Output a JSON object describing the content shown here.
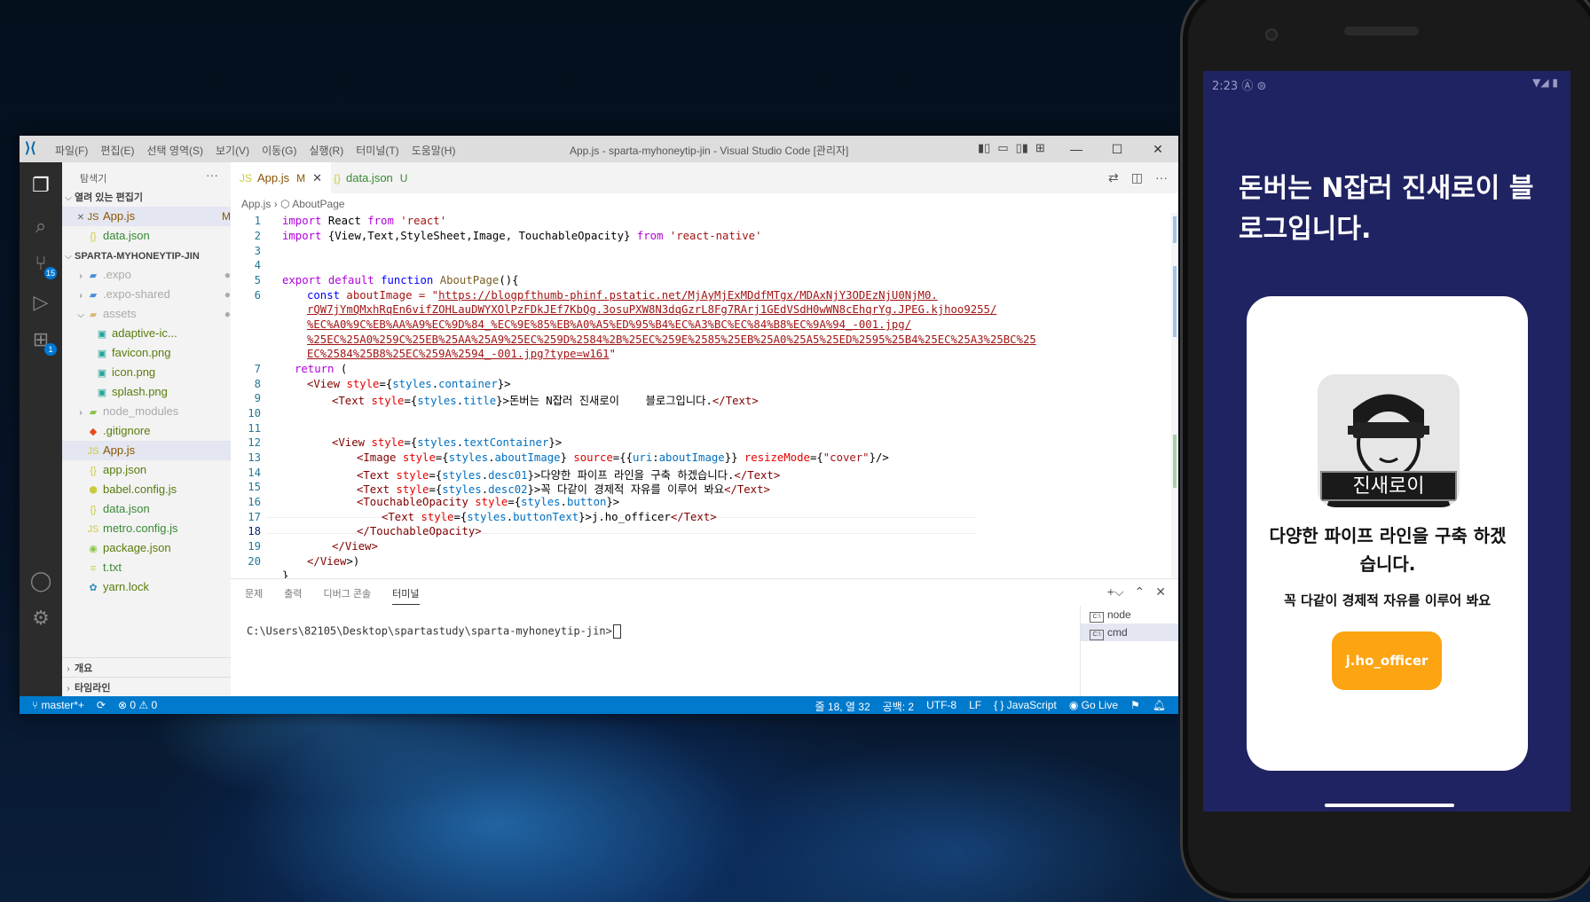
{
  "vscode": {
    "window_title": "App.js - sparta-myhoneytip-jin - Visual Studio Code [관리자]",
    "menu": [
      "파일(F)",
      "편집(E)",
      "선택 영역(S)",
      "보기(V)",
      "이동(G)",
      "실행(R)",
      "터미널(T)",
      "도움말(H)"
    ],
    "activity": {
      "source_control_badge": "15",
      "extensions_badge": "1"
    },
    "sidebar": {
      "title": "탐색기",
      "more": "···",
      "open_editors_label": "열려 있는 편집기",
      "open_editors": [
        {
          "name": "App.js",
          "status": "M"
        },
        {
          "name": "data.json",
          "status": "U"
        }
      ],
      "project_label": "SPARTA-MYHONEYTIP-JIN",
      "tree": [
        {
          "name": ".expo",
          "status": "●"
        },
        {
          "name": ".expo-shared",
          "status": "●"
        },
        {
          "name": "assets",
          "status": "●"
        },
        {
          "name": "adaptive-ic...",
          "status": "A"
        },
        {
          "name": "favicon.png",
          "status": "A"
        },
        {
          "name": "icon.png",
          "status": "A"
        },
        {
          "name": "splash.png",
          "status": "A"
        },
        {
          "name": "node_modules",
          "status": ""
        },
        {
          "name": ".gitignore",
          "status": "A"
        },
        {
          "name": "App.js",
          "status": "M"
        },
        {
          "name": "app.json",
          "status": "A"
        },
        {
          "name": "babel.config.js",
          "status": "A"
        },
        {
          "name": "data.json",
          "status": "U"
        },
        {
          "name": "metro.config.js",
          "status": "U"
        },
        {
          "name": "package.json",
          "status": "A"
        },
        {
          "name": "t.txt",
          "status": "U"
        },
        {
          "name": "yarn.lock",
          "status": "A"
        }
      ],
      "outline_label": "개요",
      "timeline_label": "타임라인"
    },
    "tabs": [
      {
        "name": "App.js",
        "status": "M"
      },
      {
        "name": "data.json",
        "status": "U"
      }
    ],
    "breadcrumb": {
      "file": "App.js",
      "symbol": "AboutPage"
    },
    "line_numbers": [
      "1",
      "2",
      "3",
      "4",
      "5",
      "6",
      "7",
      "8",
      "9",
      "10",
      "11",
      "12",
      "13",
      "14",
      "15",
      "16",
      "17",
      "18",
      "19",
      "20"
    ],
    "code": {
      "l1": [
        "import",
        " React ",
        "from",
        " 'react'"
      ],
      "l2": [
        "import",
        " {View,Text,StyleSheet,Image, TouchableOpacity} ",
        "from",
        " 'react-native'"
      ],
      "l5": [
        "export",
        " ",
        "default",
        " ",
        "function",
        " ",
        "AboutPage",
        "(){"
      ],
      "l6": [
        "const",
        " aboutImage = \""
      ],
      "url1": "https://blogpfthumb-phinf.pstatic.net/MjAyMjExMDdfMTgx/MDAxNjY3ODEzNjU0NjM0.",
      "url2": "rQW7jYmQMxhRqEn6vifZOHLauDWYXOlPzFDkJEf7KbQg.3osuPXW8N3dqGzrL8Fg7RArj1GEdVSdH0wWN8cEhqrYg.JPEG.kjhoo9255/",
      "url3": "%EC%A0%9C%EB%AA%A9%EC%9D%84_%EC%9E%85%EB%A0%A5%ED%95%B4%EC%A3%BC%EC%84%B8%EC%9A%94_-001.jpg/",
      "url4": "%25EC%25A0%259C%25EB%25AA%25A9%25EC%259D%2584%2B%25EC%259E%2585%25EB%25A0%25A5%25ED%2595%25B4%25EC%25A3%25BC%25",
      "url5": "EC%2584%25B8%25EC%259A%2594_-001.jpg?type=w161",
      "url_end": "\"",
      "l7": [
        "return",
        " ("
      ],
      "l8": [
        "<",
        "View",
        " ",
        "style",
        "={",
        "styles",
        ".",
        "container",
        "}>"
      ],
      "l9": [
        "<",
        "Text",
        " ",
        "style",
        "={",
        "styles",
        ".",
        "title",
        "}>",
        "돈버는 N잡러 진새로이    블로그입니다.",
        "</",
        "Text",
        ">"
      ],
      "l12": [
        "<",
        "View",
        " ",
        "style",
        "={",
        "styles",
        ".",
        "textContainer",
        "}>"
      ],
      "l13": [
        "<",
        "Image",
        " ",
        "style",
        "={",
        "styles",
        ".",
        "aboutImage",
        "} ",
        "source",
        "={{",
        "uri",
        ":",
        "aboutImage",
        "}} ",
        "resizeMode",
        "={",
        "\"cover\"",
        "}/>"
      ],
      "l14": [
        "<",
        "Text",
        " ",
        "style",
        "={",
        "styles",
        ".",
        "desc01",
        "}>",
        "다양한 파이프 라인을 구축 하겠습니다.",
        "</",
        "Text",
        ">"
      ],
      "l15": [
        "<",
        "Text",
        " ",
        "style",
        "={",
        "styles",
        ".",
        "desc02",
        "}>",
        "꼭 다같이 경제적 자유를 이루어 봐요",
        "</",
        "Text",
        ">"
      ],
      "l16": [
        "<",
        "TouchableOpacity",
        " ",
        "style",
        "={",
        "styles",
        ".",
        "button",
        "}>"
      ],
      "l17": [
        "<",
        "Text",
        " ",
        "style",
        "={",
        "styles",
        ".",
        "buttonText",
        "}>",
        "j.ho_officer",
        "</",
        "Text",
        ">"
      ],
      "l18": [
        "</",
        "TouchableOpacity",
        ">"
      ],
      "l19": [
        "</",
        "View",
        ">"
      ],
      "l20": [
        "</",
        "View",
        ">)"
      ],
      "l21": "}"
    },
    "panel": {
      "tabs": [
        "문제",
        "출력",
        "디버그 콘솔",
        "터미널"
      ],
      "active_tab": "터미널",
      "prompt": "C:\\Users\\82105\\Desktop\\spartastudy\\sparta-myhoneytip-jin>",
      "terminals": [
        "node",
        "cmd"
      ]
    },
    "status": {
      "branch": "master*+",
      "errors": "⊗ 0 ⚠ 0",
      "position": "줄 18, 열 32",
      "indent": "공백: 2",
      "encoding": "UTF-8",
      "eol": "LF",
      "language": "{ } JavaScript",
      "golive": "Go Live"
    }
  },
  "phone": {
    "time": "2:23",
    "title": "돈버는 N잡러 진새로이 블로그입니다.",
    "avatar_caption": "진새로이",
    "desc1": "다양한 파이프 라인을 구축 하겠습니다.",
    "desc2": "꼭 다같이 경제적 자유를 이루어 봐요",
    "button": "j.ho_officer",
    "colors": {
      "background": "#202362",
      "button": "#fda412",
      "card": "#ffffff"
    }
  }
}
